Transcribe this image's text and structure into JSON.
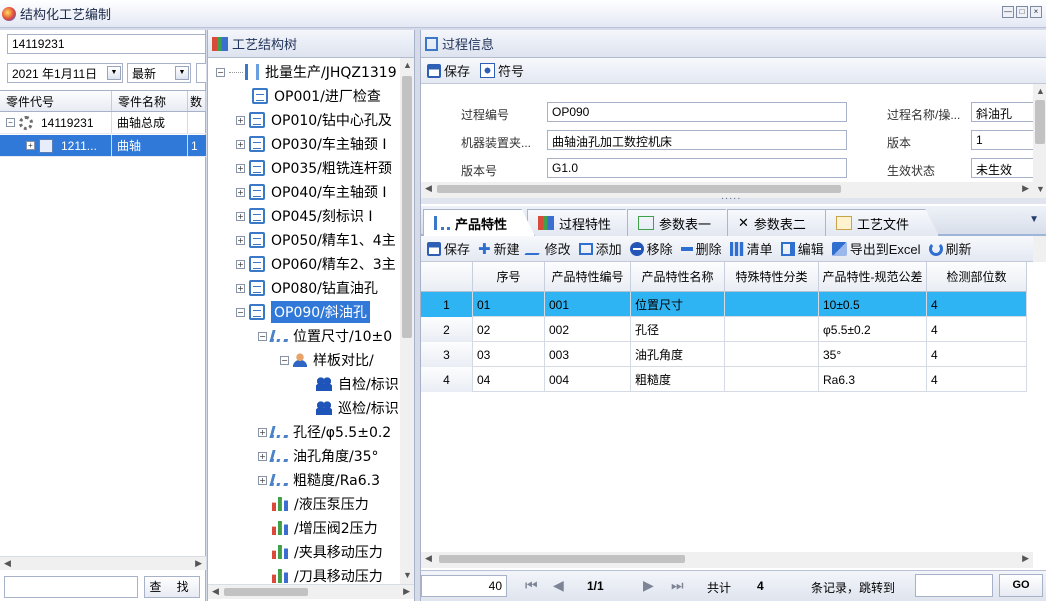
{
  "window": {
    "title": "结构化工艺编制",
    "controls": [
      "—",
      "□",
      "×"
    ]
  },
  "left": {
    "search_value": "14119231",
    "date_value": "2021 年1月11日",
    "version_select": "最新",
    "extra_select": "",
    "columns": [
      "零件代号",
      "零件名称",
      "数"
    ],
    "rows": [
      {
        "code": "14119231",
        "name": "曲轴总成",
        "qty": ""
      },
      {
        "code": "1211...",
        "name": "曲轴",
        "qty": "1"
      }
    ],
    "find_label": "查 找",
    "bottom_search_value": ""
  },
  "tree": {
    "title": "工艺结构树",
    "nodes": [
      {
        "label": "批量生产/JHQZ1319"
      },
      {
        "label": "OP001/进厂检查"
      },
      {
        "label": "OP010/钻中心孔及"
      },
      {
        "label": "OP030/车主轴颈 I"
      },
      {
        "label": "OP035/粗铣连杆颈"
      },
      {
        "label": "OP040/车主轴颈 I"
      },
      {
        "label": "OP045/刻标识 I"
      },
      {
        "label": "OP050/精车1、4主"
      },
      {
        "label": "OP060/精车2、3主"
      },
      {
        "label": "OP080/钻直油孔"
      },
      {
        "label": "OP090/斜油孔"
      },
      {
        "label": "位置尺寸/10±0"
      },
      {
        "label": "样板对比/"
      },
      {
        "label": "自检/标识"
      },
      {
        "label": "巡检/标识"
      },
      {
        "label": "孔径/φ5.5±0.2"
      },
      {
        "label": "油孔角度/35°"
      },
      {
        "label": "粗糙度/Ra6.3"
      },
      {
        "label": "/液压泵压力"
      },
      {
        "label": "/增压阀2压力"
      },
      {
        "label": "/夹具移动压力"
      },
      {
        "label": "/刀具移动压力"
      }
    ]
  },
  "process_info": {
    "title": "过程信息",
    "save_label": "保存",
    "symbol_label": "符号",
    "fields": {
      "process_no_label": "过程编号",
      "process_no_value": "OP090",
      "process_name_label": "过程名称/操...",
      "process_name_value": "斜油孔",
      "machine_label": "机器装置夹...",
      "machine_value": "曲轴油孔加工数控机床",
      "version_label": "版本",
      "version_value": "1",
      "version_no_label": "版本号",
      "version_no_value": "G1.0",
      "status_label": "生效状态",
      "status_value": "未生效"
    }
  },
  "tabs": [
    {
      "label": "产品特性",
      "active": true
    },
    {
      "label": "过程特性",
      "active": false
    },
    {
      "label": "参数表一",
      "active": false
    },
    {
      "label": "参数表二",
      "active": false
    },
    {
      "label": "工艺文件",
      "active": false
    }
  ],
  "grid_toolbar": {
    "save": "保存",
    "new": "新建",
    "modify": "修改",
    "add": "添加",
    "remove": "移除",
    "delete": "删除",
    "clear": "清单",
    "edit": "编辑",
    "export": "导出到Excel",
    "refresh": "刷新"
  },
  "grid": {
    "columns": [
      "",
      "序号",
      "产品特性编号",
      "产品特性名称",
      "特殊特性分类",
      "产品特性-规范公差",
      "检测部位数"
    ],
    "rows": [
      {
        "n": "1",
        "seq": "01",
        "code": "001",
        "name": "位置尺寸",
        "special": "",
        "spec": "10±0.5",
        "count": "4"
      },
      {
        "n": "2",
        "seq": "02",
        "code": "002",
        "name": "孔径",
        "special": "",
        "spec": "φ5.5±0.2",
        "count": "4"
      },
      {
        "n": "3",
        "seq": "03",
        "code": "003",
        "name": "油孔角度",
        "special": "",
        "spec": "35°",
        "count": "4"
      },
      {
        "n": "4",
        "seq": "04",
        "code": "004",
        "name": "粗糙度",
        "special": "",
        "spec": "Ra6.3",
        "count": "4"
      }
    ]
  },
  "pager": {
    "page_size": "40",
    "page": "1/1",
    "total_label": "共计",
    "total": "4",
    "suffix": "条记录，跳转到",
    "go": "GO"
  },
  "colors": {
    "selection": "#3179d8",
    "grid_selection": "#2fb4f3",
    "accent": "#2f6fd0"
  }
}
